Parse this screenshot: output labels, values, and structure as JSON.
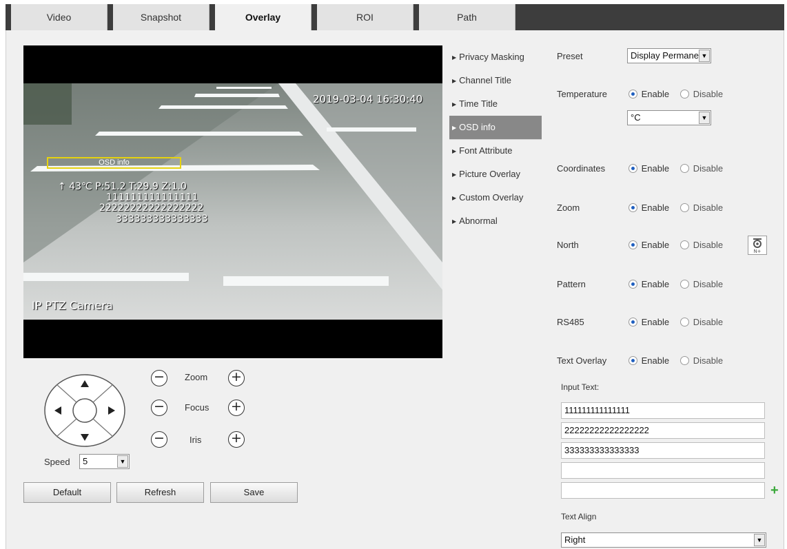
{
  "tabs": [
    "Video",
    "Snapshot",
    "Overlay",
    "ROI",
    "Path"
  ],
  "active_tab": "Overlay",
  "video": {
    "timestamp": "2019-03-04 16:30:40",
    "osd_box_label": "OSD info",
    "osd_line1": "↑ 43℃ P:51.2 T:29.9 Z:1.0",
    "osd_line2": "111111111111111",
    "osd_line3": "22222222222222222",
    "osd_line4": "333333333333333",
    "channel_title": "IP PTZ Camera"
  },
  "submenu": {
    "items": [
      "Privacy Masking",
      "Channel Title",
      "Time Title",
      "OSD info",
      "Font Attribute",
      "Picture Overlay",
      "Custom Overlay",
      "Abnormal"
    ],
    "active": "OSD info"
  },
  "form": {
    "preset_label": "Preset",
    "preset_value": "Display Permane",
    "temperature_label": "Temperature",
    "unit_value": "°C",
    "coordinates_label": "Coordinates",
    "zoom_label": "Zoom",
    "north_label": "North",
    "pattern_label": "Pattern",
    "rs485_label": "RS485",
    "text_overlay_label": "Text Overlay",
    "enable": "Enable",
    "disable": "Disable",
    "input_text_label": "Input Text:",
    "input_lines": [
      "111111111111111",
      "22222222222222222",
      "333333333333333",
      "",
      ""
    ],
    "text_align_label": "Text Align",
    "text_align_value": "Right"
  },
  "ptz": {
    "zoom": "Zoom",
    "focus": "Focus",
    "iris": "Iris",
    "speed_label": "Speed",
    "speed_value": "5"
  },
  "buttons": {
    "default": "Default",
    "refresh": "Refresh",
    "save": "Save"
  },
  "icons": {
    "dpad": "dpad-icon",
    "north": "north-calibrate-icon",
    "add": "plus-icon"
  },
  "colors": {
    "tab_bar": "#3d3d3d",
    "submenu_active": "#888888",
    "osd_box": "#e6d20f",
    "add_icon": "#3aa83a"
  }
}
